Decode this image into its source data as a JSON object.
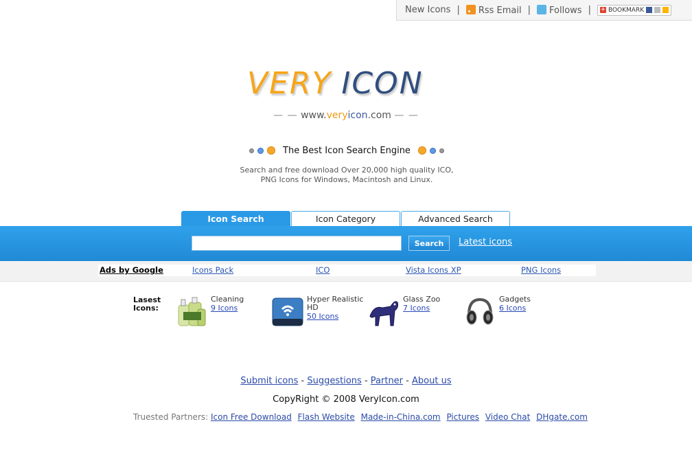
{
  "topbar": {
    "new_icons": "New Icons",
    "sep": "|",
    "rss_email": "Rss Email",
    "follows": "Follows",
    "bookmark": "BOOKMARK"
  },
  "logo": {
    "word1": "VERY",
    "word2": "ICON"
  },
  "url": {
    "left_dash": "— —",
    "prefix": "www.",
    "very": "very",
    "icon": "icon",
    "suffix": ".com",
    "right_dash": "— —"
  },
  "tagline": "The Best Icon Search Engine",
  "description": "Search and free download Over 20,000 high quality ICO, PNG Icons for Windows, Macintosh and Linux.",
  "tabs": [
    {
      "label": "Icon Search",
      "active": true
    },
    {
      "label": "Icon Category",
      "active": false
    },
    {
      "label": "Advanced Search",
      "active": false
    }
  ],
  "search": {
    "value": "",
    "button": "Search",
    "latest_link": "Latest icons"
  },
  "ads": {
    "label": "Ads by Google",
    "links": [
      "Icons Pack",
      "ICO",
      "Vista Icons XP",
      "PNG Icons"
    ]
  },
  "latest": {
    "label_line1": "Lasest",
    "label_line2": "Icons:",
    "items": [
      {
        "name": "Cleaning",
        "count": "9 Icons",
        "icon": "cleaning-bottles-icon"
      },
      {
        "name": "Hyper Realistic HD",
        "count": "50 Icons",
        "icon": "hard-drive-icon"
      },
      {
        "name": "Glass Zoo",
        "count": "7 Icons",
        "icon": "glass-cat-icon"
      },
      {
        "name": "Gadgets",
        "count": "6 Icons",
        "icon": "headphones-icon"
      }
    ]
  },
  "footer": {
    "links": [
      "Submit icons",
      "Suggestions",
      "Partner",
      "About us"
    ],
    "link_sep": "-",
    "copyright": "CopyRight © 2008 VeryIcon.com",
    "partners_label": "Truested Partners:",
    "partners": [
      "Icon Free Download",
      "Flash Website",
      "Made-in-China.com",
      "Pictures",
      "Video Chat",
      "DHgate.com"
    ]
  }
}
